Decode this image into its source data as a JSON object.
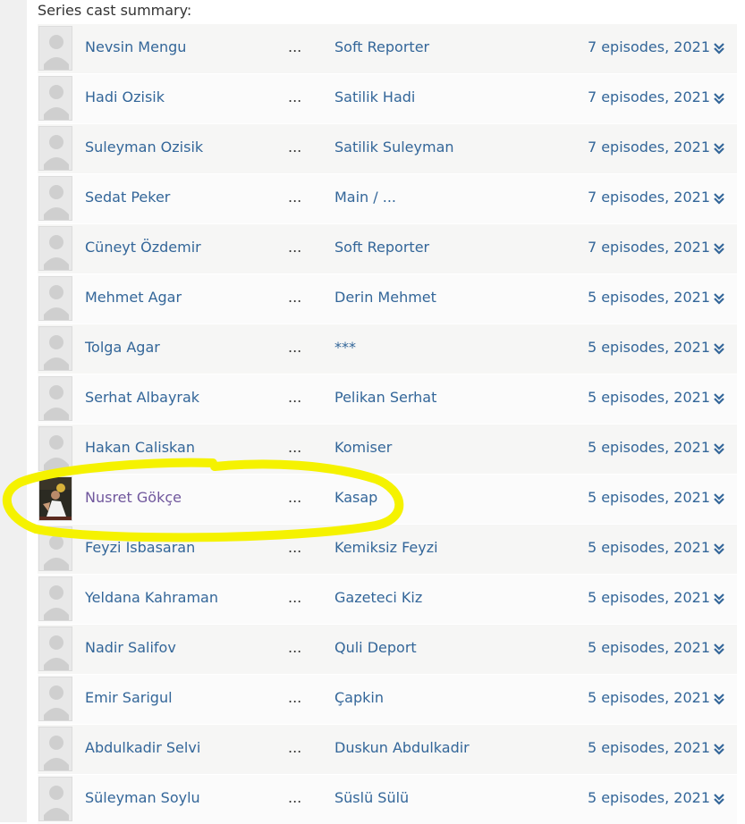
{
  "heading": "Series cast summary:",
  "cast": [
    {
      "actor": "Nevsin Mengu",
      "sep": "...",
      "character": "Soft Reporter",
      "episodes": "7 episodes, 2021"
    },
    {
      "actor": "Hadi Ozisik",
      "sep": "...",
      "character": "Satilik Hadi",
      "episodes": "7 episodes, 2021"
    },
    {
      "actor": "Suleyman Ozisik",
      "sep": "...",
      "character": "Satilik Suleyman",
      "episodes": "7 episodes, 2021"
    },
    {
      "actor": "Sedat Peker",
      "sep": "...",
      "character": "Main / ...",
      "episodes": "7 episodes, 2021"
    },
    {
      "actor": "Cüneyt Özdemir",
      "sep": "...",
      "character": "Soft Reporter",
      "episodes": "7 episodes, 2021"
    },
    {
      "actor": "Mehmet Agar",
      "sep": "...",
      "character": "Derin Mehmet",
      "episodes": "5 episodes, 2021"
    },
    {
      "actor": "Tolga Agar",
      "sep": "...",
      "character": "***",
      "episodes": "5 episodes, 2021"
    },
    {
      "actor": "Serhat Albayrak",
      "sep": "...",
      "character": "Pelikan Serhat",
      "episodes": "5 episodes, 2021"
    },
    {
      "actor": "Hakan Caliskan",
      "sep": "...",
      "character": "Komiser",
      "episodes": "5 episodes, 2021"
    },
    {
      "actor": "Nusret Gökçe",
      "sep": "...",
      "character": "Kasap",
      "episodes": "5 episodes, 2021"
    },
    {
      "actor": "Feyzi Isbasaran",
      "sep": "...",
      "character": "Kemiksiz Feyzi",
      "episodes": "5 episodes, 2021"
    },
    {
      "actor": "Yeldana Kahraman",
      "sep": "...",
      "character": "Gazeteci Kiz",
      "episodes": "5 episodes, 2021"
    },
    {
      "actor": "Nadir Salifov",
      "sep": "...",
      "character": "Quli Deport",
      "episodes": "5 episodes, 2021"
    },
    {
      "actor": "Emir Sarigul",
      "sep": "...",
      "character": "Çapkin",
      "episodes": "5 episodes, 2021"
    },
    {
      "actor": "Abdulkadir Selvi",
      "sep": "...",
      "character": "Duskun Abdulkadir",
      "episodes": "5 episodes, 2021"
    },
    {
      "actor": "Süleyman Soylu",
      "sep": "...",
      "character": "Süslü Sülü",
      "episodes": "5 episodes, 2021"
    }
  ],
  "icons": {
    "avatar_placeholder": "person-silhouette-icon",
    "expand": "double-chevron-down-icon"
  },
  "colors": {
    "link": "#336699",
    "visited_link": "#70579d",
    "highlight_marker": "#f5f200"
  }
}
